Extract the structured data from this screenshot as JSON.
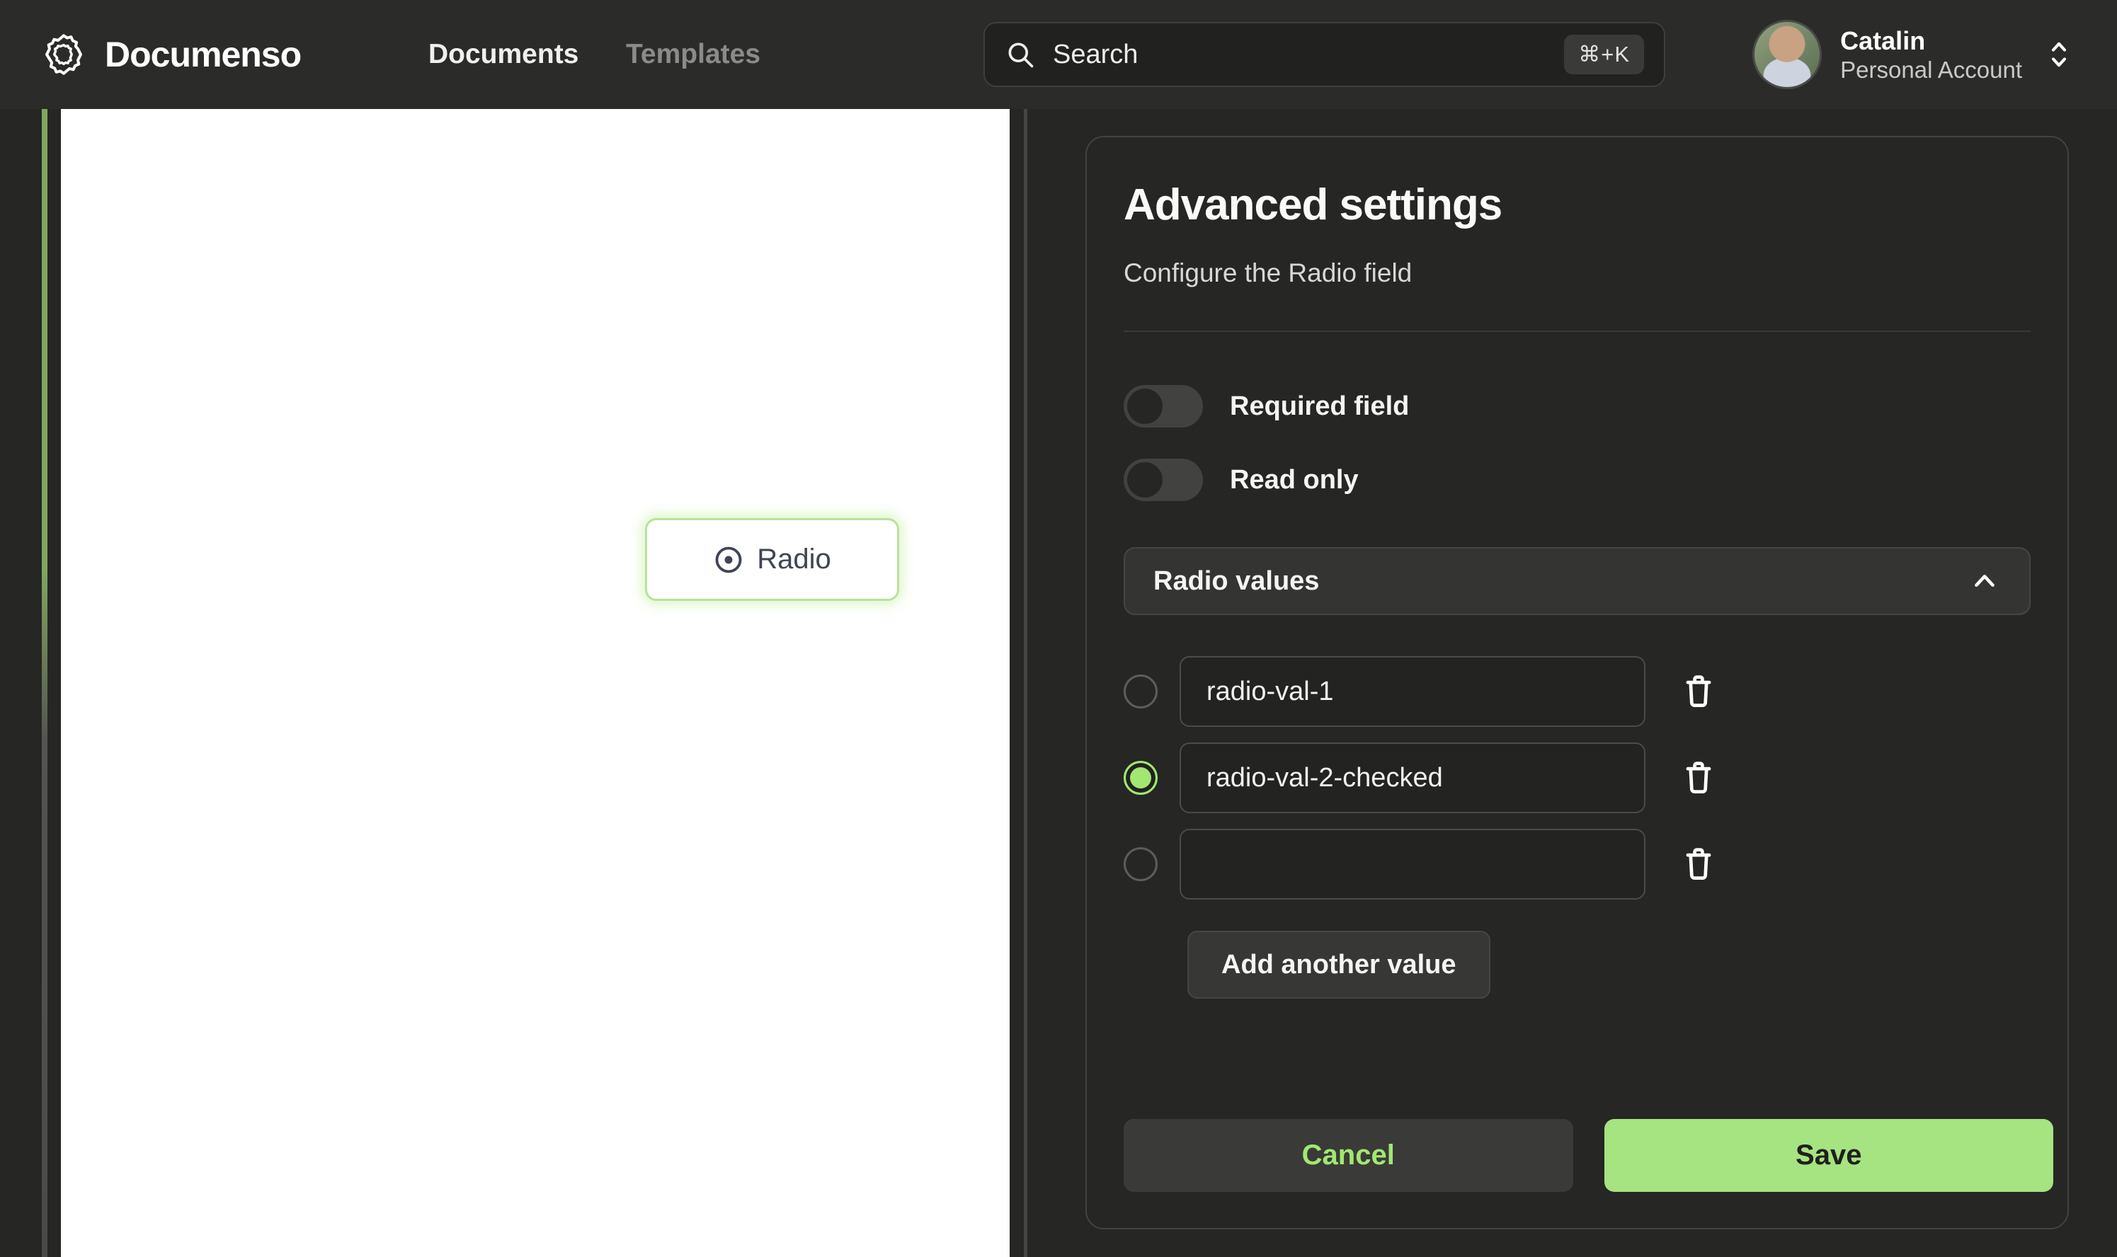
{
  "header": {
    "brand": "Documenso",
    "nav": {
      "documents": "Documents",
      "templates": "Templates"
    },
    "search": {
      "placeholder": "Search",
      "shortcut": "⌘+K"
    },
    "account": {
      "name": "Catalin",
      "type": "Personal Account"
    }
  },
  "document": {
    "field_label": "Radio"
  },
  "panel": {
    "title": "Advanced settings",
    "subtitle": "Configure the Radio field",
    "toggles": [
      {
        "label": "Required field",
        "on": false
      },
      {
        "label": "Read only",
        "on": false
      }
    ],
    "section": {
      "label": "Radio values"
    },
    "values": [
      {
        "value": "radio-val-1",
        "checked": false
      },
      {
        "value": "radio-val-2-checked",
        "checked": true
      },
      {
        "value": "",
        "checked": false
      }
    ],
    "add_button_label": "Add another value",
    "cancel_label": "Cancel",
    "save_label": "Save"
  },
  "colors": {
    "accent_green": "#a2e771",
    "save_green": "#a6e381",
    "topbar_bg": "#2b2b29",
    "body_bg": "#262624",
    "field_border_green": "#bce09c"
  }
}
